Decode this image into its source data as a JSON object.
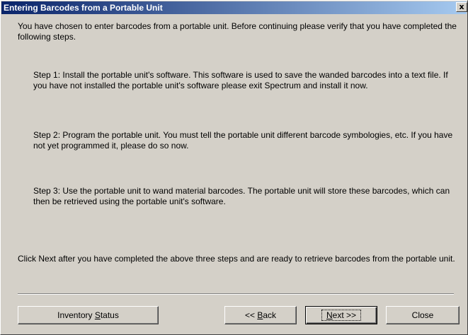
{
  "window": {
    "title": "Entering Barcodes from a Portable Unit",
    "close_glyph": "x"
  },
  "body": {
    "intro": "You have chosen to enter barcodes from a portable unit.  Before continuing please verify that you have completed the following steps.",
    "step1": "Step 1: Install the portable unit's software.  This software is used to save the wanded barcodes into a text file.  If you have not installed the portable unit's software please exit Spectrum and install it now.",
    "step2": "Step 2: Program the portable unit.  You must tell the portable unit different barcode symbologies, etc.  If you have not yet programmed it, please do so now.",
    "step3": "Step 3: Use the portable unit to wand material barcodes.  The portable unit will store these barcodes, which can then be retrieved using the portable unit's software.",
    "closing": "Click Next after you have completed the above three steps and are ready to retrieve barcodes from the portable unit."
  },
  "buttons": {
    "inventory_status": {
      "pre": "Inventory ",
      "u": "S",
      "post": "tatus"
    },
    "back": {
      "pre": "<< ",
      "u": "B",
      "post": "ack"
    },
    "next": {
      "pre": "",
      "u": "N",
      "post": "ext >>"
    },
    "close": "Close"
  }
}
